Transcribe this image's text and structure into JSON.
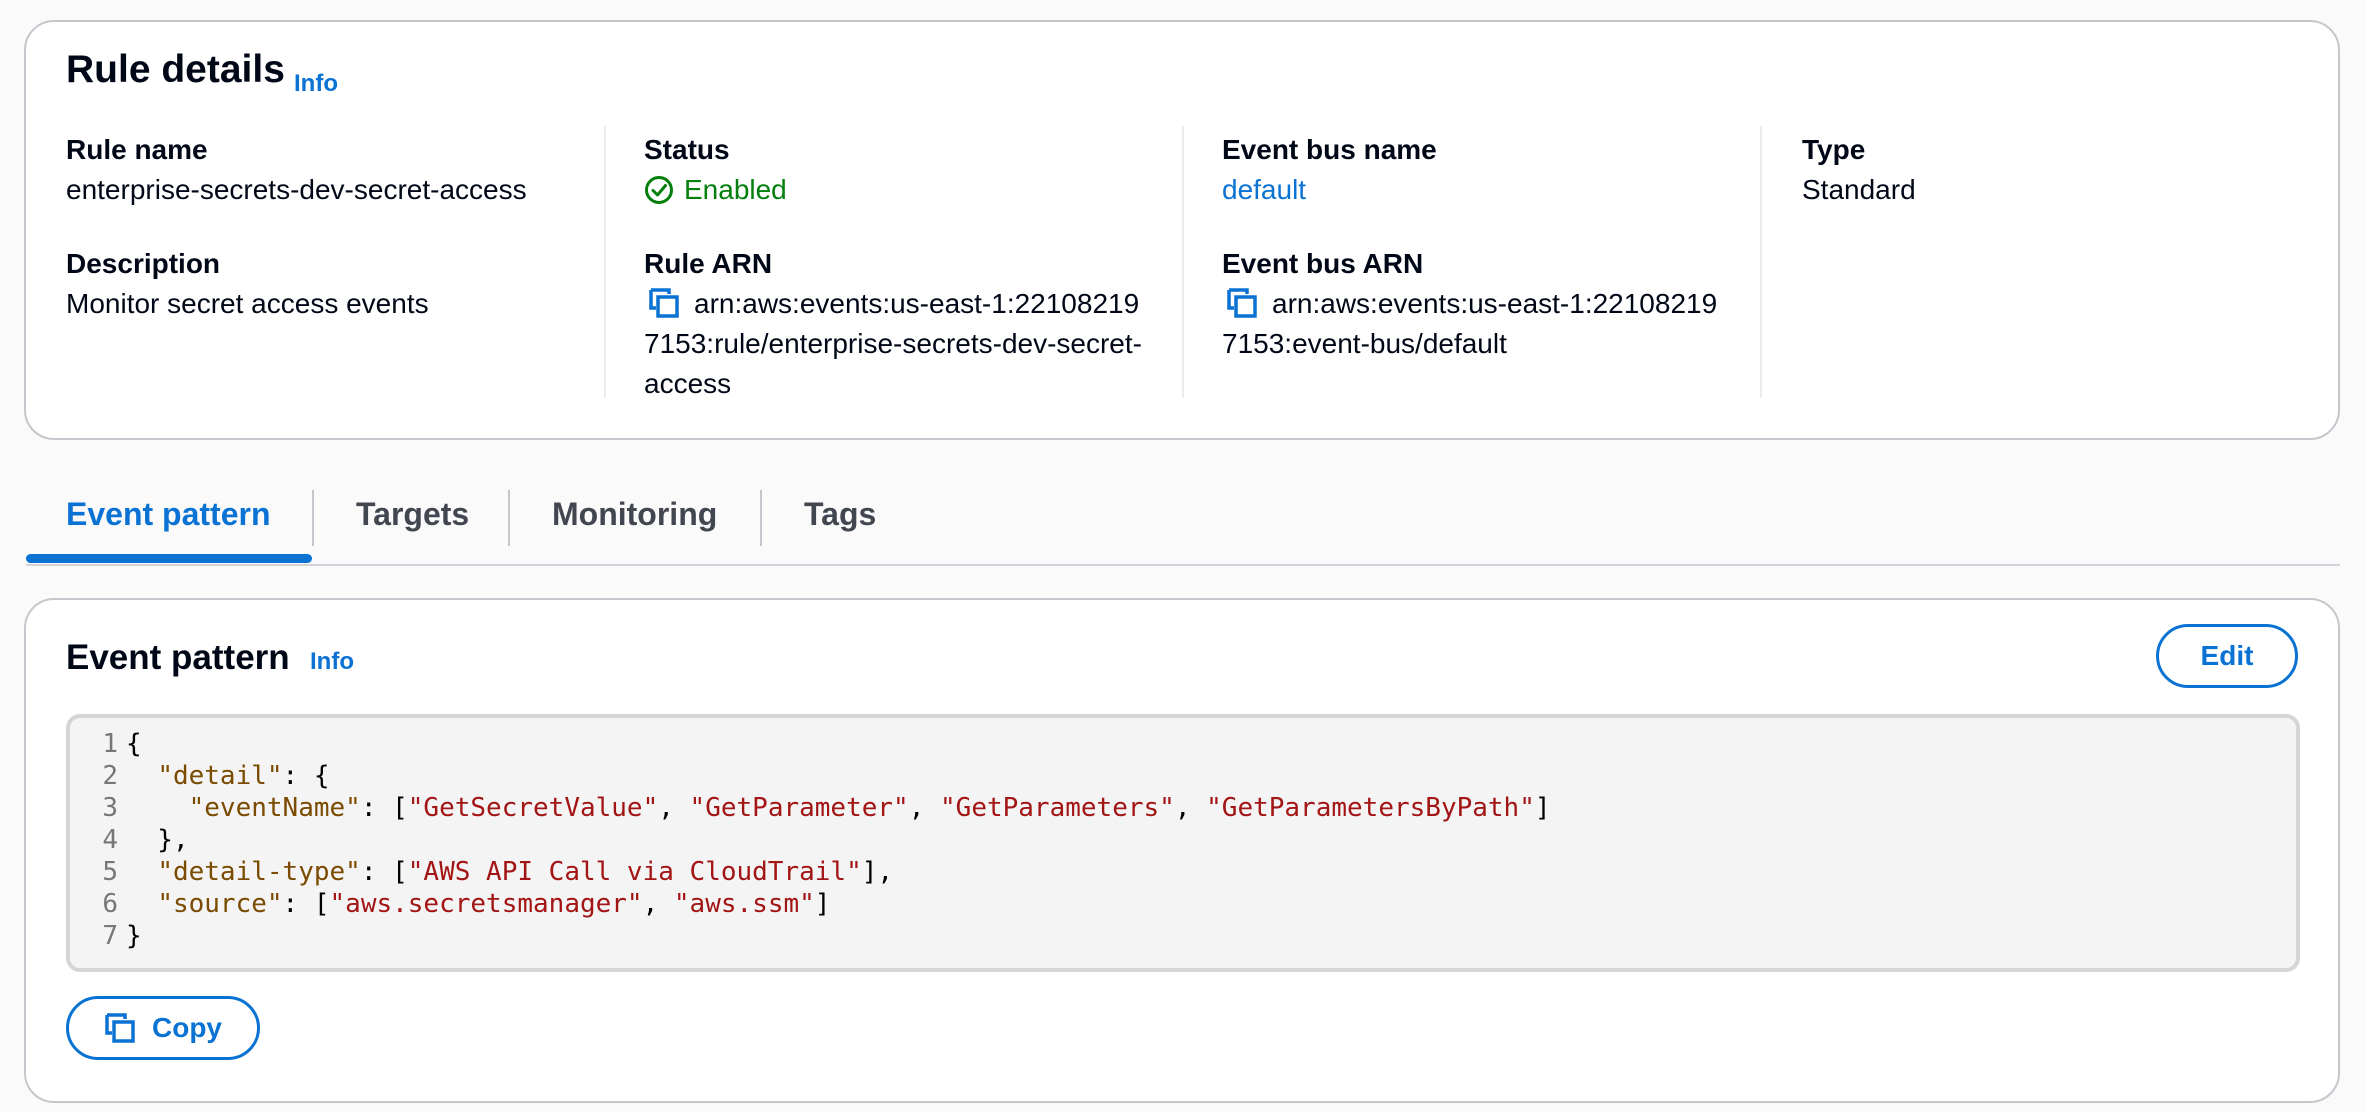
{
  "rule_details": {
    "title": "Rule details",
    "info_label": "Info",
    "rule_name": {
      "label": "Rule name",
      "value": "enterprise-secrets-dev-secret-access"
    },
    "description": {
      "label": "Description",
      "value": "Monitor secret access events"
    },
    "status": {
      "label": "Status",
      "value": "Enabled",
      "color": "#037f0c",
      "icon": "check-circle-icon"
    },
    "rule_arn": {
      "label": "Rule ARN",
      "value": "arn:aws:events:us-east-1:221082197153:rule/enterprise-secrets-dev-secret-access",
      "icon": "copy-icon"
    },
    "event_bus_name": {
      "label": "Event bus name",
      "value": "default"
    },
    "event_bus_arn": {
      "label": "Event bus ARN",
      "value": "arn:aws:events:us-east-1:221082197153:event-bus/default",
      "icon": "copy-icon"
    },
    "type": {
      "label": "Type",
      "value": "Standard"
    }
  },
  "tabs": [
    {
      "label": "Event pattern",
      "active": true
    },
    {
      "label": "Targets",
      "active": false
    },
    {
      "label": "Monitoring",
      "active": false
    },
    {
      "label": "Tags",
      "active": false
    }
  ],
  "event_pattern": {
    "title": "Event pattern",
    "info_label": "Info",
    "edit_label": "Edit",
    "copy_label": "Copy",
    "code_lines": [
      {
        "num": "1",
        "text": "{"
      },
      {
        "num": "2",
        "text": "  \"detail\": {"
      },
      {
        "num": "3",
        "text": "    \"eventName\": [\"GetSecretValue\", \"GetParameter\", \"GetParameters\", \"GetParametersByPath\"]"
      },
      {
        "num": "4",
        "text": "  },"
      },
      {
        "num": "5",
        "text": "  \"detail-type\": [\"AWS API Call via CloudTrail\"],"
      },
      {
        "num": "6",
        "text": "  \"source\": [\"aws.secretsmanager\", \"aws.ssm\"]"
      },
      {
        "num": "7",
        "text": "}"
      }
    ]
  },
  "colors": {
    "accent": "#0972d3",
    "success": "#037f0c",
    "border": "#c6c6cd",
    "code_key": "#7a4b00",
    "code_string": "#a31515"
  }
}
